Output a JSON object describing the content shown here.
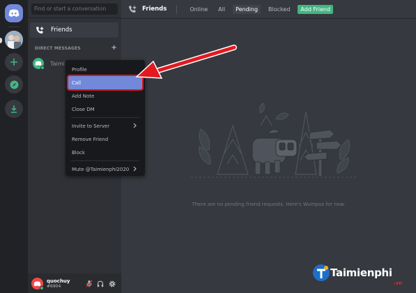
{
  "rail": {
    "icons": [
      "discord-home-icon",
      "server-avatar",
      "add-server-icon",
      "explore-icon",
      "download-icon"
    ]
  },
  "sidebar": {
    "search_placeholder": "Find or start a conversation",
    "friends_label": "Friends",
    "dm_header": "DIRECT MESSAGES",
    "dm_add": "+",
    "dm_items": [
      {
        "name": "Taimi"
      }
    ]
  },
  "user": {
    "name": "quochuy",
    "tag": "#6904"
  },
  "topbar": {
    "title": "Friends",
    "tabs": [
      {
        "label": "Online",
        "active": false
      },
      {
        "label": "All",
        "active": false
      },
      {
        "label": "Pending",
        "active": true
      },
      {
        "label": "Blocked",
        "active": false
      }
    ],
    "add_friend": "Add Friend"
  },
  "main": {
    "empty_text": "There are no pending friend requests. Here's Wumpus for now."
  },
  "context_menu": {
    "items": [
      {
        "label": "Profile"
      },
      {
        "label": "Call",
        "highlighted": true
      },
      {
        "label": "Add Note"
      },
      {
        "label": "Close DM"
      },
      {
        "label": "Invite to Server",
        "submenu": true
      },
      {
        "label": "Remove Friend"
      },
      {
        "label": "Block"
      },
      {
        "label": "Mute @Taimienphi2020",
        "submenu": true
      }
    ]
  },
  "watermark": {
    "text": "Taimienphi",
    "sub": ".vn"
  },
  "colors": {
    "blurple": "#7289da",
    "green": "#43b581",
    "highlight_border": "#d71920",
    "arrow": "#e3191f"
  }
}
